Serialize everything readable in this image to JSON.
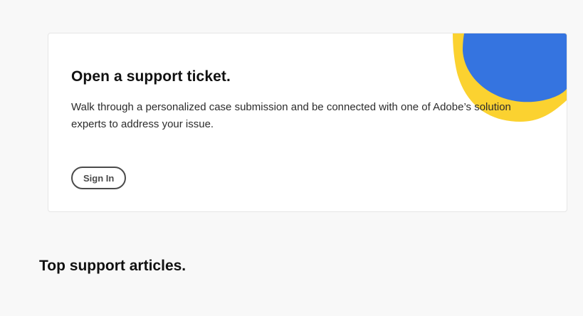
{
  "support_card": {
    "title": "Open a support ticket.",
    "description": "Walk through a personalized case submission and be connected with one of Adobe’s solution experts to address your issue.",
    "sign_in_label": "Sign In"
  },
  "articles_section": {
    "title": "Top support articles."
  },
  "colors": {
    "accent_blue": "#3574e0",
    "accent_yellow": "#fbd230",
    "background": "#f8f8f8",
    "card": "#ffffff"
  },
  "icons": {
    "decoration": "blue-yellow-blob-decoration"
  }
}
